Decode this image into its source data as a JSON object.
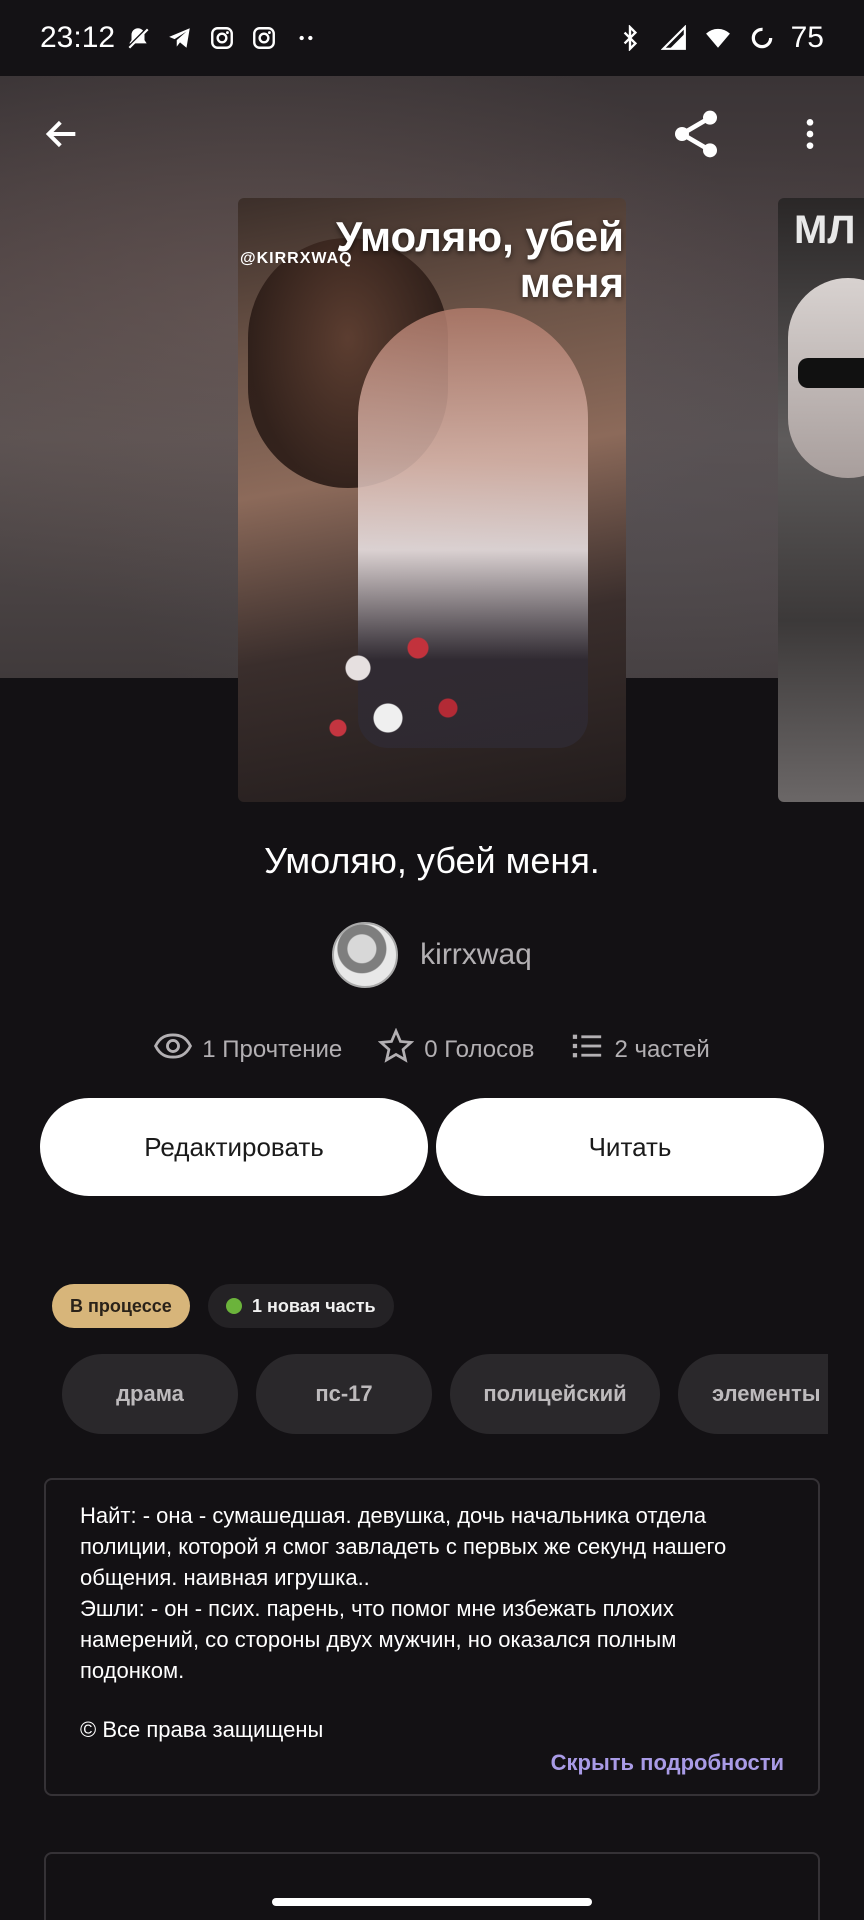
{
  "status_bar": {
    "time": "23:12",
    "left_icons": [
      "mute-icon",
      "telegram-icon",
      "instagram-icon",
      "instagram-icon",
      "more-dots-icon"
    ],
    "right_icons": [
      "bluetooth-icon",
      "signal-icon",
      "wifi-icon",
      "battery-icon"
    ],
    "battery": "75"
  },
  "header": {
    "back_icon": "arrow-left-icon",
    "share_icon": "share-icon",
    "menu_icon": "more-vertical-icon"
  },
  "cover": {
    "title_text": "Умоляю, убей меня",
    "handle": "@KIRRXWAQ",
    "next_cover_title": "МЛ"
  },
  "story": {
    "title": "Умоляю, убей меня.",
    "author": "kirrxwaq"
  },
  "stats": {
    "reads": "1 Прочтение",
    "votes": "0 Голосов",
    "parts": "2 частей"
  },
  "actions": {
    "edit": "Редактировать",
    "read": "Читать"
  },
  "badges": {
    "status": "В процессе",
    "new_part": "1 новая часть"
  },
  "tags": [
    "драма",
    "пс-17",
    "полицейский",
    "элементы"
  ],
  "description": {
    "text": "Найт: - она - сумашедшая. девушка, дочь начальника отдела полиции, которой я смог завладеть с первых же секунд нашего общения. наивная игрушка..\nЭшли: - он - псих. парень, что помог мне избежать плохих намерений, со стороны двух мужчин, но оказался полным подонком.",
    "copyright": "© Все права защищены",
    "toggle": "Скрыть подробности"
  },
  "colors": {
    "background": "#131114",
    "badge_progress": "#d7b57a",
    "new_dot": "#6bb33b",
    "link": "#a99be6"
  }
}
